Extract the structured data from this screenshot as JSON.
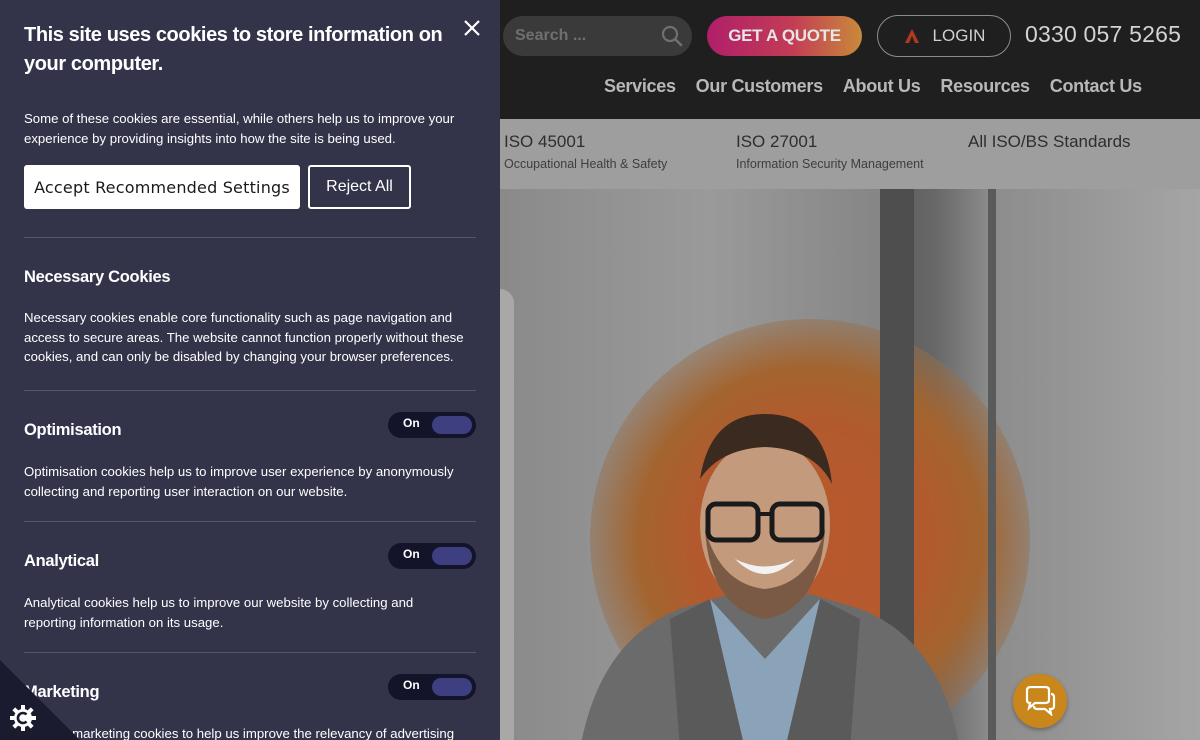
{
  "site": {
    "search": {
      "placeholder": "Search ..."
    },
    "quote_label": "GET A QUOTE",
    "login_label": "LOGIN",
    "phone": "0330 057 5265",
    "nav": [
      "Services",
      "Our Customers",
      "About Us",
      "Resources",
      "Contact Us"
    ],
    "standards": [
      {
        "code": "ISO 45001",
        "desc": "Occupational Health & Safety"
      },
      {
        "code": "ISO 27001",
        "desc": "Information Security Management"
      },
      {
        "code": "All ISO/BS Standards",
        "desc": ""
      }
    ]
  },
  "cookie": {
    "title": "This site uses cookies to store information on your computer.",
    "intro": "Some of these cookies are essential, while others help us to improve your experience by providing insights into how the site is being used.",
    "accept_label": "Accept Recommended Settings",
    "reject_label": "Reject All",
    "necessary": {
      "title": "Necessary Cookies",
      "desc": "Necessary cookies enable core functionality such as page navigation and access to secure areas. The website cannot function properly without these cookies, and can only be disabled by changing your browser preferences."
    },
    "optimisation": {
      "title": "Optimisation",
      "toggle": "On",
      "desc": "Optimisation cookies help us to improve user experience by anonymously collecting and reporting user interaction on our website."
    },
    "analytical": {
      "title": "Analytical",
      "toggle": "On",
      "desc": "Analytical cookies help us to improve our website by collecting and reporting information on its usage."
    },
    "marketing": {
      "title": "Marketing",
      "toggle": "On",
      "desc": "We use marketing cookies to help us improve the relevancy of advertising"
    }
  },
  "colors": {
    "panel_bg": "#33344a",
    "toggle_on": "#3e3f80",
    "quote_gradient_start": "#b01f6a",
    "quote_gradient_end": "#c98a3a",
    "chat_button": "#c9861b"
  },
  "icons": [
    "search-icon",
    "close-icon",
    "login-logo-icon",
    "chat-icon",
    "cookie-settings-icon"
  ]
}
